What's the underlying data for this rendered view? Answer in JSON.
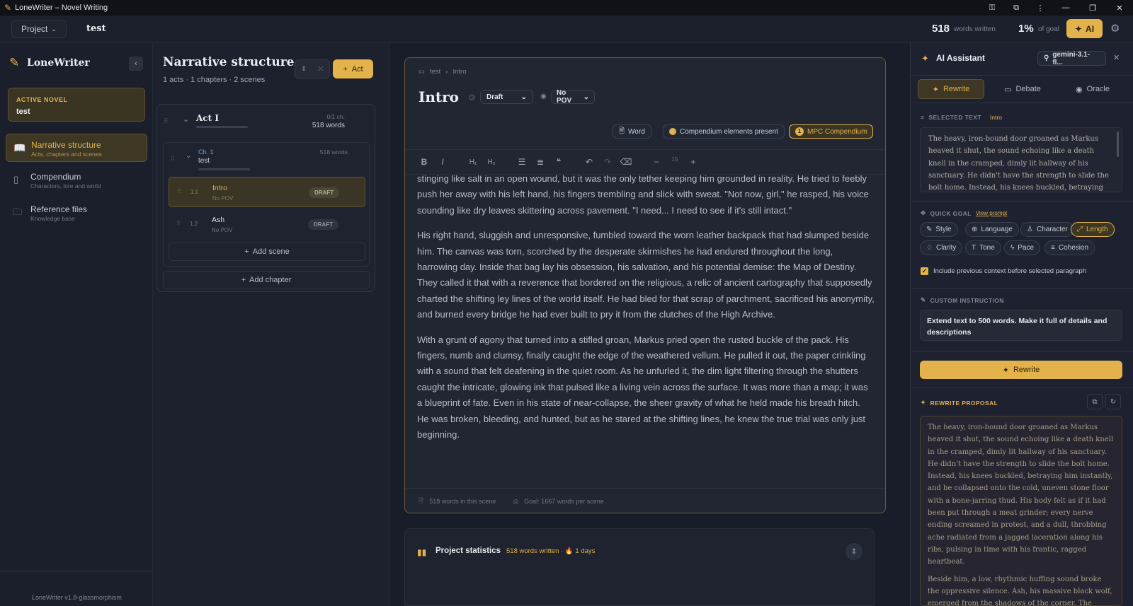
{
  "window": {
    "title": "LoneWriter – Novel Writing"
  },
  "topbar": {
    "project_label": "Project",
    "novel_name": "test",
    "words_count": "518",
    "words_label": "words written",
    "goal_pct": "1%",
    "goal_label": "of goal",
    "ai_label": "AI"
  },
  "sidebar": {
    "app_name": "LoneWriter",
    "active_novel_label": "ACTIVE NOVEL",
    "active_novel_name": "test",
    "items": [
      {
        "label": "Narrative structure",
        "sub": "Acts, chapters and scenes"
      },
      {
        "label": "Compendium",
        "sub": "Characters, lore and world"
      },
      {
        "label": "Reference files",
        "sub": "Knowledge base"
      }
    ],
    "version": "LoneWriter v1.8-glassmorphism"
  },
  "structure": {
    "title": "Narrative structure",
    "summary": "1 acts · 1 chapters · 2 scenes",
    "add_act": "Act",
    "act": {
      "name": "Act I",
      "chapters": "0/1 ch.",
      "words": "518 words"
    },
    "chapter": {
      "num": "Ch. 1",
      "name": "test",
      "words": "518 words"
    },
    "scenes": [
      {
        "num": "1.1",
        "name": "Intro",
        "pov": "No POV",
        "status": "DRAFT"
      },
      {
        "num": "1.2",
        "name": "Ash",
        "pov": "No POV",
        "status": "DRAFT"
      }
    ],
    "add_scene": "Add scene",
    "add_chapter": "Add chapter"
  },
  "editor": {
    "breadcrumb": [
      "test",
      "Intro"
    ],
    "scene_title": "Intro",
    "status": "Draft",
    "pov": "No POV",
    "word_btn": "Word",
    "compendium_present": "Compendium elements present",
    "mpc_count": "1",
    "mpc_label": "MPC Compendium",
    "font_size": "15",
    "paragraphs": [
      "stinging like salt in an open wound, but it was the only tether keeping him grounded in reality. He tried to feebly push her away with his left hand, his fingers trembling and slick with sweat. \"Not now, girl,\" he rasped, his voice sounding like dry leaves skittering across pavement. \"I need... I need to see if it's still intact.\"",
      "His right hand, sluggish and unresponsive, fumbled toward the worn leather backpack that had slumped beside him. The canvas was torn, scorched by the desperate skirmishes he had endured throughout the long, harrowing day. Inside that bag lay his obsession, his salvation, and his potential demise: the Map of Destiny. They called it that with a reverence that bordered on the religious, a relic of ancient cartography that supposedly charted the shifting ley lines of the world itself. He had bled for that scrap of parchment, sacrificed his anonymity, and burned every bridge he had ever built to pry it from the clutches of the High Archive.",
      "With a grunt of agony that turned into a stifled groan, Markus pried open the rusted buckle of the pack. His fingers, numb and clumsy, finally caught the edge of the weathered vellum. He pulled it out, the paper crinkling with a sound that felt deafening in the quiet room. As he unfurled it, the dim light filtering through the shutters caught the intricate, glowing ink that pulsed like a living vein across the surface. It was more than a map; it was a blueprint of fate. Even in his state of near-collapse, the sheer gravity of what he held made his breath hitch. He was broken, bleeding, and hunted, but as he stared at the shifting lines, he knew the true trial was only just beginning."
    ],
    "footer_words": "518 words in this scene",
    "footer_goal": "Goal: 1667 words per scene"
  },
  "stats": {
    "label": "Project statistics",
    "summary": "518 words written · ",
    "days": "1 days",
    "fire": "🔥"
  },
  "ai": {
    "title": "AI Assistant",
    "model": "gemini-3.1-fl...",
    "tabs": [
      "Rewrite",
      "Debate",
      "Oracle"
    ],
    "selected_label": "SELECTED TEXT",
    "selected_ref": "Intro",
    "selected_text": "The heavy, iron-bound door groaned as Markus heaved it shut, the sound echoing like a death knell in the cramped, dimly lit hallway of his sanctuary. He didn't have the strength to slide the bolt home. Instead, his knees buckled, betraying him instantly, and he",
    "quick_goal_label": "QUICK GOAL",
    "view_prompt": "View prompt",
    "goals": [
      "Style",
      "Language",
      "Character",
      "Length",
      "Clarity",
      "Tone",
      "Pace",
      "Cohesion"
    ],
    "include_context": "Include previous context before selected paragraph",
    "custom_label": "CUSTOM INSTRUCTION",
    "custom_text": "Extend text to 500 words. Make it full of details and descriptions",
    "rewrite_btn": "Rewrite",
    "proposal_label": "REWRITE PROPOSAL",
    "proposal_p1": "The heavy, iron-bound door groaned as Markus heaved it shut, the sound echoing like a death knell in the cramped, dimly lit hallway of his sanctuary. He didn't have the strength to slide the bolt home. Instead, his knees buckled, betraying him instantly, and he collapsed onto the cold, uneven stone floor with a bone-jarring thud. His body felt as if it had been put through a meat grinder; every nerve ending screamed in protest, and a dull, throbbing ache radiated from a jagged laceration along his ribs, pulsing in time with his frantic, ragged heartbeat.",
    "proposal_p2": "Beside him, a low, rhythmic huffing sound broke the oppressive silence. Ash, his massive black wolf, emerged from the shadows of the corner. The beast's"
  }
}
